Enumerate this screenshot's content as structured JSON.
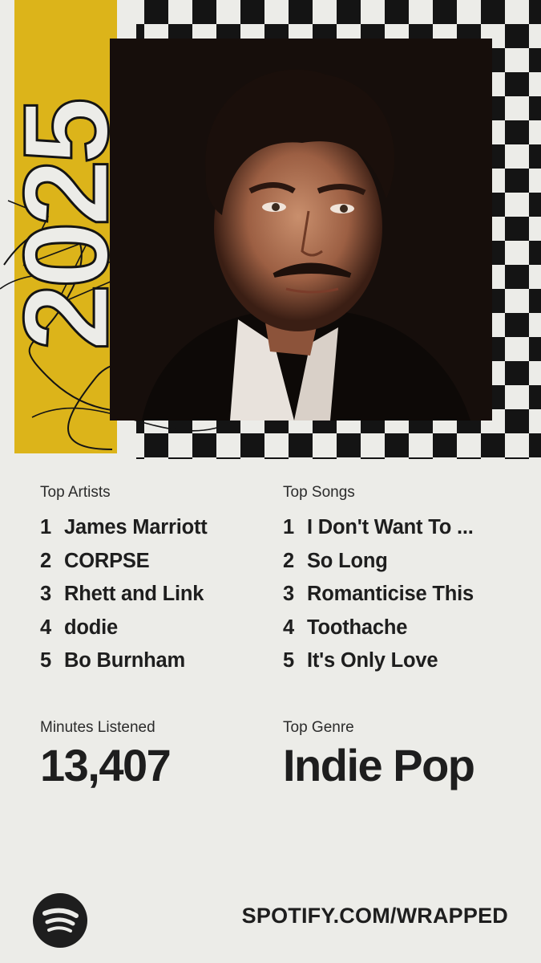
{
  "colors": {
    "background": "#ecece8",
    "accent_yellow": "#dcb41a",
    "checker_dark": "#141414",
    "text": "#1e1e1e"
  },
  "art": {
    "year": "2025",
    "photo_icon": "portrait-photo"
  },
  "top_artists": {
    "label": "Top Artists",
    "items": [
      {
        "rank": "1",
        "name": "James Marriott"
      },
      {
        "rank": "2",
        "name": "CORPSE"
      },
      {
        "rank": "3",
        "name": "Rhett and Link"
      },
      {
        "rank": "4",
        "name": "dodie"
      },
      {
        "rank": "5",
        "name": "Bo Burnham"
      }
    ]
  },
  "top_songs": {
    "label": "Top Songs",
    "items": [
      {
        "rank": "1",
        "name": "I Don't Want To ..."
      },
      {
        "rank": "2",
        "name": "So Long"
      },
      {
        "rank": "3",
        "name": "Romanticise This"
      },
      {
        "rank": "4",
        "name": "Toothache"
      },
      {
        "rank": "5",
        "name": "It's Only Love"
      }
    ]
  },
  "minutes": {
    "label": "Minutes Listened",
    "value": "13,407"
  },
  "genre": {
    "label": "Top Genre",
    "value": "Indie Pop"
  },
  "footer": {
    "logo_icon": "spotify-logo-icon",
    "url": "SPOTIFY.COM/WRAPPED"
  }
}
